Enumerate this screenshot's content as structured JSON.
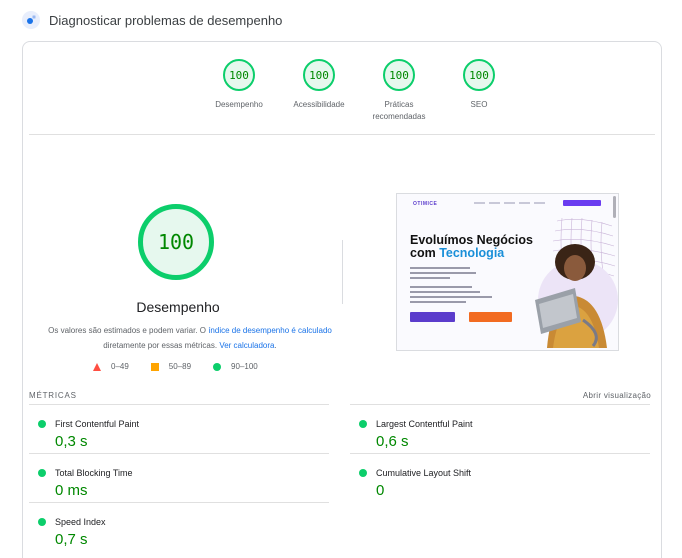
{
  "header": {
    "title": "Diagnosticar problemas de desempenho",
    "icon": "lighthouse-icon"
  },
  "summary_gauges": [
    {
      "score": "100",
      "label": "Desempenho"
    },
    {
      "score": "100",
      "label": "Acessibilidade"
    },
    {
      "score": "100",
      "label": "Práticas recomendadas"
    },
    {
      "score": "100",
      "label": "SEO"
    }
  ],
  "main_gauge": {
    "score": "100",
    "label": "Desempenho"
  },
  "note": {
    "prefix": "Os valores são estimados e podem variar. O ",
    "link1": "índice de desempenho é calculado",
    "middle": " diretamente por essas métricas. ",
    "link2": "Ver calculadora",
    "suffix": "."
  },
  "legend": {
    "fail": "0–49",
    "average": "50–89",
    "pass": "90–100"
  },
  "colors": {
    "pass": "#0cce6b",
    "average": "#ffa400",
    "fail": "#ff4e42",
    "pass_text": "#008800",
    "link": "#1a73e8"
  },
  "screenshot": {
    "logo": "OTIMICE",
    "headline_line1": "Evoluímos Negócios",
    "headline_line2_plain": "com ",
    "headline_line2_accent": "Tecnologia"
  },
  "metrics": {
    "heading": "MÉTRICAS",
    "expand_label": "Abrir visualização",
    "items": [
      {
        "name": "First Contentful Paint",
        "value": "0,3 s"
      },
      {
        "name": "Largest Contentful Paint",
        "value": "0,6 s"
      },
      {
        "name": "Total Blocking Time",
        "value": "0 ms"
      },
      {
        "name": "Cumulative Layout Shift",
        "value": "0"
      },
      {
        "name": "Speed Index",
        "value": "0,7 s"
      }
    ]
  }
}
